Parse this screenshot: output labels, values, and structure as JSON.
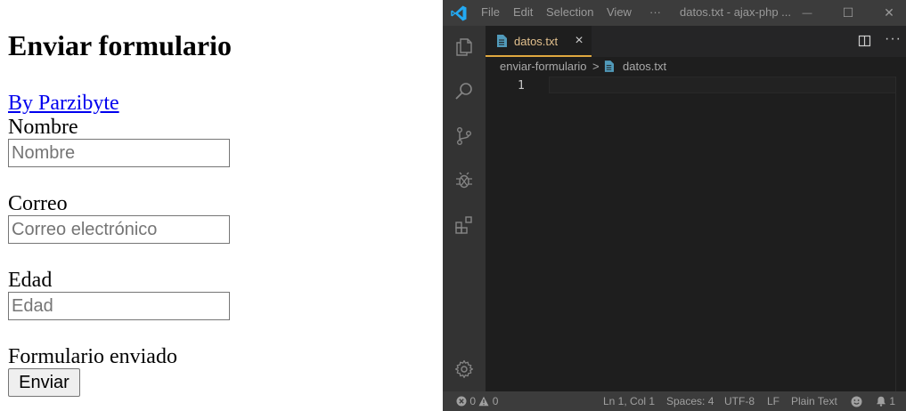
{
  "browser_page": {
    "heading": "Enviar formulario",
    "author_link": "By Parzibyte",
    "name_label": "Nombre",
    "name_placeholder": "Nombre",
    "email_label": "Correo",
    "email_placeholder": "Correo electrónico",
    "age_label": "Edad",
    "age_placeholder": "Edad",
    "status_message": "Formulario enviado",
    "submit_label": "Enviar"
  },
  "vscode": {
    "menu": {
      "file": "File",
      "edit": "Edit",
      "selection": "Selection",
      "view": "View",
      "more": "···"
    },
    "window_title": "datos.txt - ajax-php ...",
    "window_controls": {
      "minimize": "—",
      "maximize": "☐",
      "close": "✕"
    },
    "activity_icons": [
      "explorer-icon",
      "search-icon",
      "source-control-icon",
      "debug-icon",
      "extensions-icon",
      "settings-gear-icon"
    ],
    "tab": {
      "name": "datos.txt",
      "close": "×"
    },
    "tab_actions": {
      "more": "···"
    },
    "breadcrumb": {
      "folder": "enviar-formulario",
      "separator": ">",
      "file": "datos.txt"
    },
    "editor": {
      "line_number": "1"
    },
    "status_bar": {
      "errors": "0",
      "warnings": "0",
      "position": "Ln 1, Col 1",
      "spaces": "Spaces: 4",
      "encoding": "UTF-8",
      "eol": "LF",
      "language": "Plain Text",
      "notifications": "1"
    },
    "colors": {
      "accent": "#007acc",
      "tab_active_border": "#e0a83f",
      "tab_text": "#e2c08d",
      "file_icon": "#519aba"
    }
  }
}
